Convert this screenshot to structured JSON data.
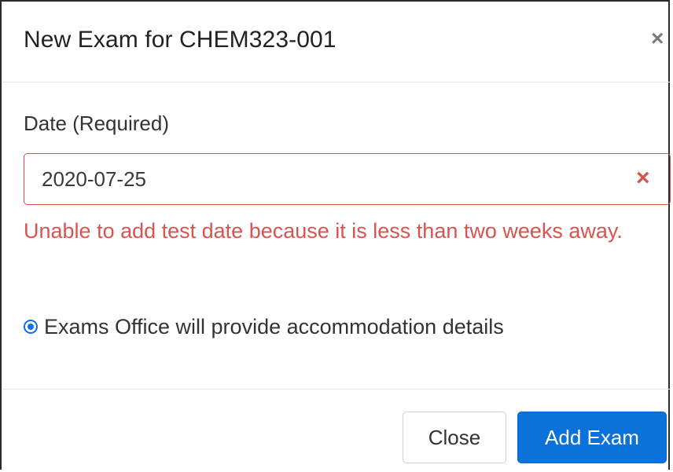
{
  "modal": {
    "title": "New Exam for CHEM323-001",
    "close_icon": "close-icon"
  },
  "date_field": {
    "label": "Date (Required)",
    "value": "2020-07-25",
    "error_icon": "error-x-icon",
    "error_message": "Unable to add test date because it is less than two weeks away."
  },
  "accommodation": {
    "option_label": "Exams Office will provide accommodation details",
    "selected": true
  },
  "footer": {
    "close_label": "Close",
    "add_label": "Add Exam"
  },
  "colors": {
    "error": "#d9534f",
    "primary": "#0b72d9",
    "radio": "#0d6efd"
  }
}
